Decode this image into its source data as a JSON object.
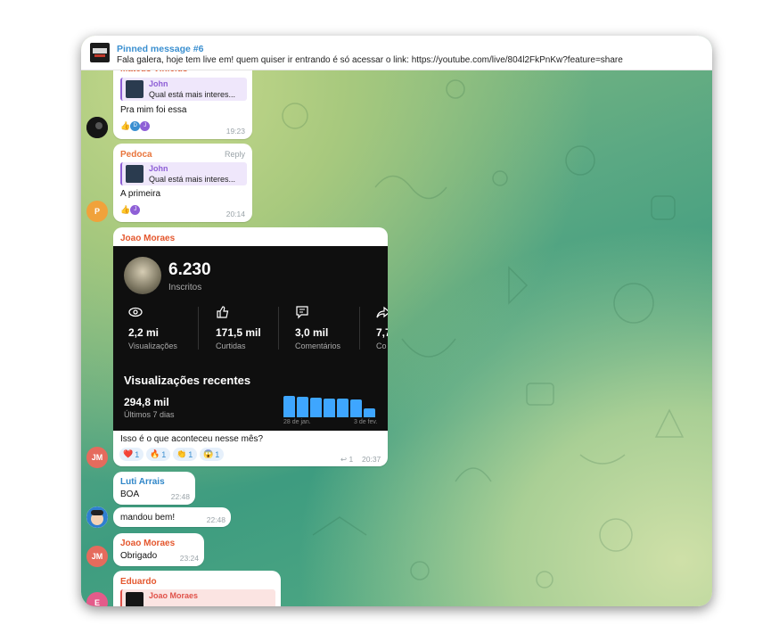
{
  "pinned": {
    "title": "Pinned message #6",
    "text": "Fala galera, hoje tem live em! quem quiser ir entrando é só acessar o link: https://youtube.com/live/804l2FkPnKw?feature=share"
  },
  "messages": {
    "m1": {
      "sender": "Mateus Vinícius",
      "reply_name": "John",
      "reply_text": "Qual está mais interes...",
      "text": "Pra mim foi essa",
      "time": "19:23"
    },
    "m2": {
      "sender": "Pedoca",
      "reply_label": "Reply",
      "reply_name": "John",
      "reply_text": "Qual está mais interes...",
      "text": "A primeira",
      "time": "20:14",
      "avatar": "P"
    },
    "m3": {
      "sender": "Joao Moraes",
      "caption": "Isso é o que aconteceu nesse mês?",
      "time": "20:37",
      "reply_count": "1",
      "avatar": "JM",
      "reactions": [
        {
          "emoji": "❤️",
          "count": "1"
        },
        {
          "emoji": "🔥",
          "count": "1"
        },
        {
          "emoji": "👏",
          "count": "1"
        },
        {
          "emoji": "😱",
          "count": "1"
        }
      ]
    },
    "m4": {
      "sender": "Luti Arrais",
      "text": "BOA",
      "time": "22:48"
    },
    "m5": {
      "text": "mandou bem!",
      "time": "22:48"
    },
    "m6": {
      "sender": "Joao Moraes",
      "text": "Obrigado",
      "time": "23:24",
      "avatar": "JM"
    },
    "m7": {
      "sender": "Eduardo",
      "reply_name": "Joao Moraes",
      "avatar": "E"
    }
  },
  "youtube_card": {
    "subscribers": "6.230",
    "subscribers_label": "Inscritos",
    "stats": [
      {
        "value": "2,2 mi",
        "label": "Visualizações"
      },
      {
        "value": "171,5 mil",
        "label": "Curtidas"
      },
      {
        "value": "3,0 mil",
        "label": "Comentários"
      },
      {
        "value": "7,7",
        "label": "Co"
      }
    ],
    "recent_title": "Visualizações recentes",
    "recent_value": "294,8 mil",
    "recent_label": "Últimos 7 dias",
    "date_start": "28 de jan.",
    "date_end": "3 de fev.",
    "bars": [
      0.92,
      0.88,
      0.85,
      0.82,
      0.82,
      0.78,
      0.38
    ]
  },
  "colors": {
    "sender_red": "#e4572e",
    "sender_orange": "#e8743b",
    "sender_blue": "#2f86c8",
    "reply_purple": "#8e5fd6",
    "reply_red": "#e0524a",
    "bar_blue": "#3ea6ff"
  }
}
